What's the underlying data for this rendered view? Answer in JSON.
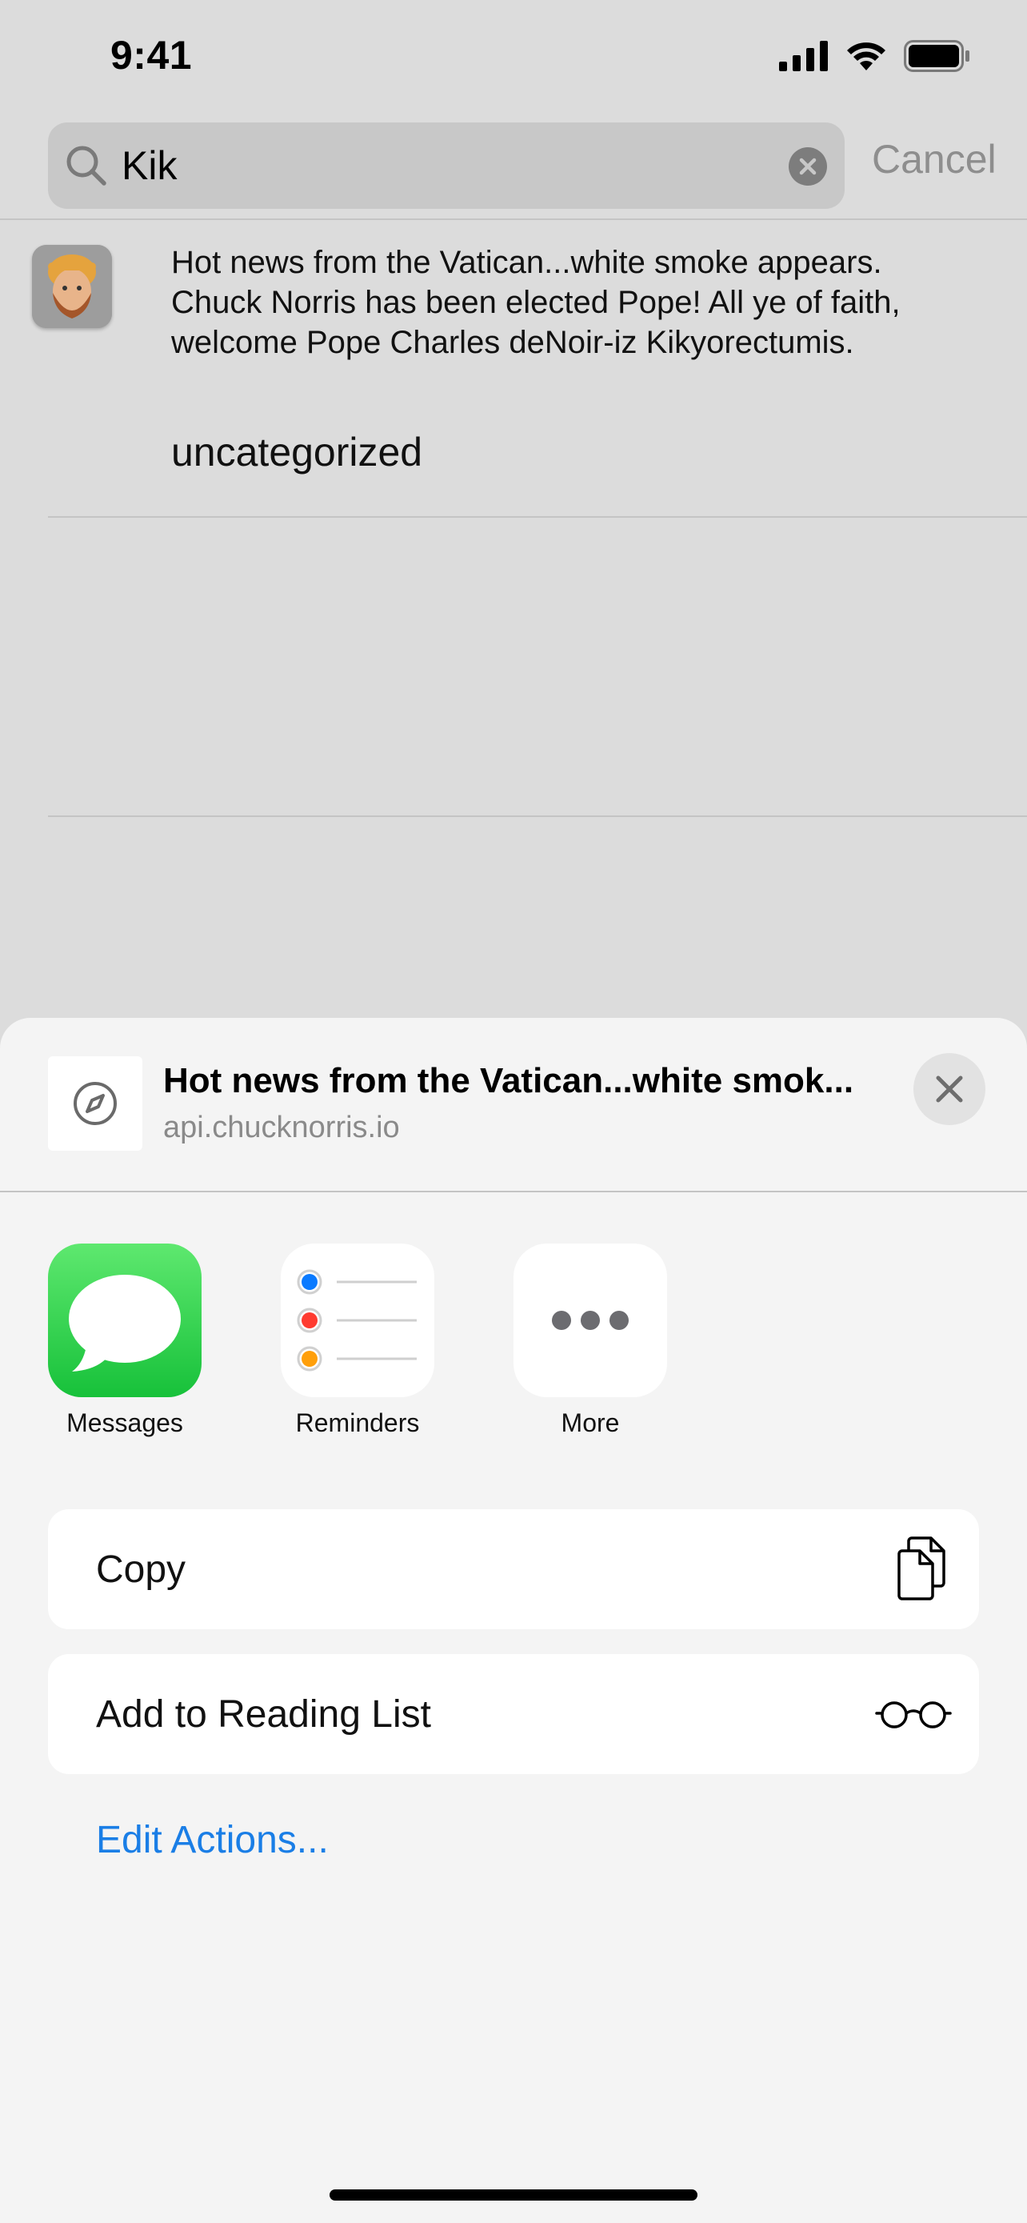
{
  "status_bar": {
    "time": "9:41"
  },
  "search": {
    "query": "Kik",
    "cancel_label": "Cancel"
  },
  "result": {
    "joke_text": "Hot news from the Vatican...white smoke appears. Chuck Norris has been elected Pope! All ye of faith, welcome Pope Charles deNoir-iz Kikyorectumis.",
    "category": "uncategorized"
  },
  "share_sheet": {
    "title": "Hot news from the Vatican...white smok...",
    "subtitle": "api.chucknorris.io",
    "apps": [
      {
        "label": "Messages",
        "icon": "messages-icon"
      },
      {
        "label": "Reminders",
        "icon": "reminders-icon"
      },
      {
        "label": "More",
        "icon": "more-icon"
      }
    ],
    "actions": [
      {
        "label": "Copy",
        "icon": "copy-icon"
      },
      {
        "label": "Add to Reading List",
        "icon": "glasses-icon"
      }
    ],
    "edit_actions_label": "Edit Actions..."
  },
  "colors": {
    "link_blue": "#1a7ee6",
    "messages_green": "#2fcf4e",
    "reminder_blue": "#0a7aff",
    "reminder_red": "#ff3b30",
    "reminder_orange": "#ff9f0a"
  }
}
